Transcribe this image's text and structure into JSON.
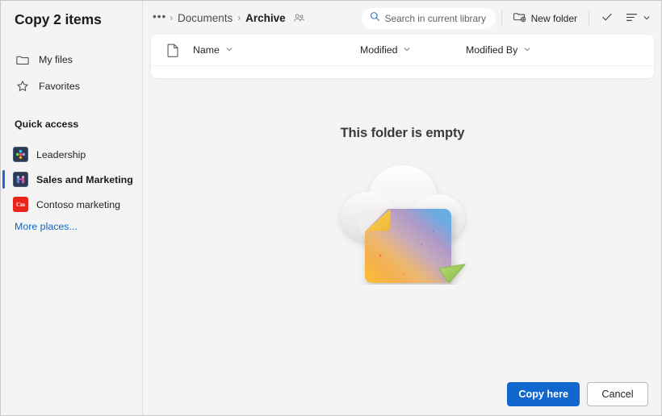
{
  "dialog": {
    "title": "Copy 2 items"
  },
  "sidebar": {
    "nav": [
      {
        "label": "My files",
        "icon": "folder-icon"
      },
      {
        "label": "Favorites",
        "icon": "star-icon"
      }
    ],
    "section_title": "Quick access",
    "quick_access": [
      {
        "label": "Leadership",
        "icon": "teamsite-icon",
        "selected": false
      },
      {
        "label": "Sales and Marketing",
        "icon": "teamsite-icon",
        "selected": true
      },
      {
        "label": "Contoso marketing",
        "icon": "contoso-icon",
        "badge": "Cm",
        "selected": false
      }
    ],
    "more_places": "More places..."
  },
  "breadcrumb": {
    "overflow": "•••",
    "separator": "›",
    "items": [
      {
        "label": "Documents",
        "current": false
      },
      {
        "label": "Archive",
        "current": true
      }
    ],
    "shared_icon": "people-shared-icon"
  },
  "toolbar": {
    "search_placeholder": "Search in current library",
    "search_value": "",
    "search_icon": "search-icon",
    "new_folder_label": "New folder",
    "new_folder_icon": "new-folder-icon",
    "check_icon": "checkmark-icon",
    "sort_icon": "sort-list-icon",
    "sort_chevron_icon": "chevron-down-icon"
  },
  "file_list": {
    "columns": [
      {
        "label": "Name",
        "chevron": "chevron-down-icon"
      },
      {
        "label": "Modified",
        "chevron": "chevron-down-icon"
      },
      {
        "label": "Modified By",
        "chevron": "chevron-down-icon"
      }
    ],
    "doc_icon": "document-icon",
    "rows": []
  },
  "empty_state": {
    "title": "This folder is empty",
    "illustration": "cloud-document-cursor-illustration"
  },
  "footer": {
    "primary_label": "Copy here",
    "secondary_label": "Cancel"
  },
  "colors": {
    "accent": "#1267cf",
    "link": "#1266c0",
    "background": "#f4f4f4",
    "card": "#ffffff",
    "contoso_red": "#e8241b",
    "teamsite_navy": "#2b3a52",
    "cursor_green": "#9ccb5a"
  }
}
